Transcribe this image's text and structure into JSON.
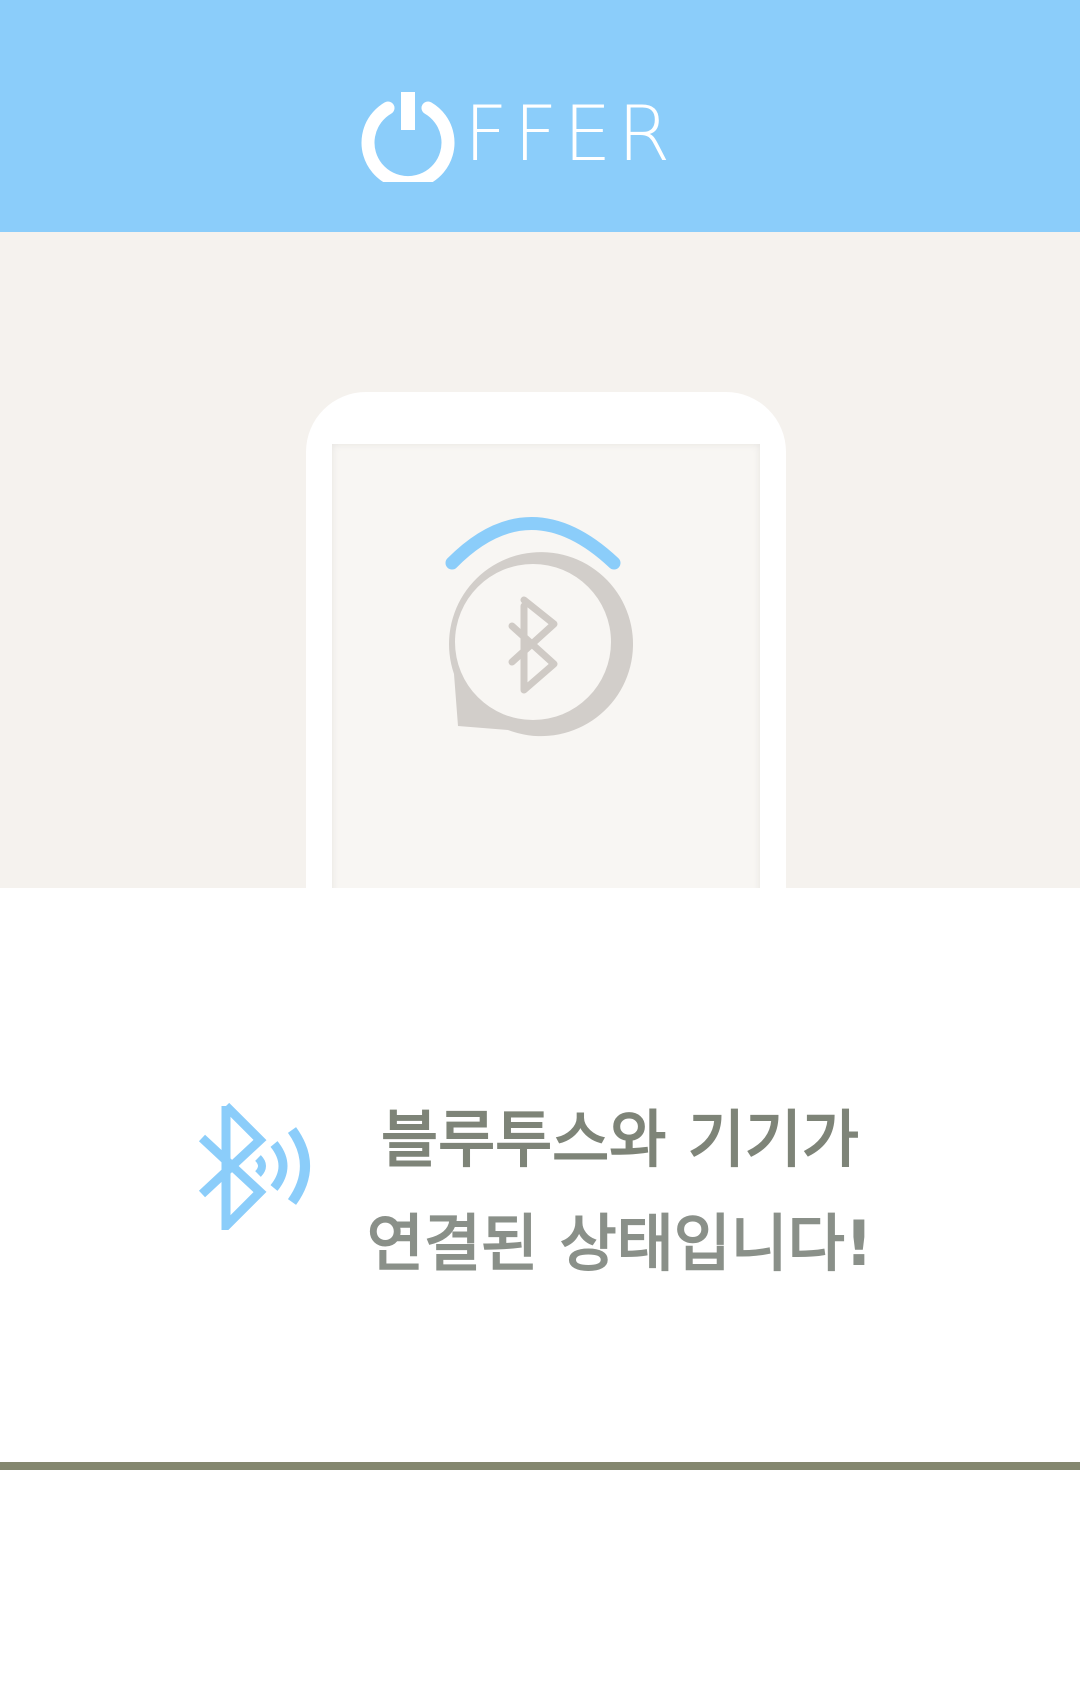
{
  "header": {
    "brand": "FFER",
    "logo_icon": "power-icon",
    "background": "#8bcdfa"
  },
  "hero": {
    "background": "#f5f2ee",
    "screen_icon": "bluetooth-scan-icon",
    "arc_color": "#8bcdfa"
  },
  "message": {
    "icon": "bluetooth-signal-icon",
    "line1": "블루투스와 기기가",
    "line2": "연결된 상태입니다!"
  },
  "colors": {
    "accent": "#8bcdfa",
    "text": "#7b7b6b",
    "divider": "#84876f"
  }
}
